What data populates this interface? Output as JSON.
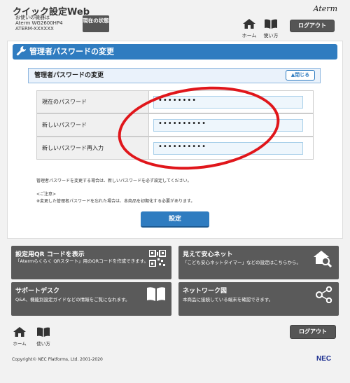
{
  "header": {
    "app_title": "クイック設定Web",
    "device_label": "お使いの機器は",
    "device_model": "Aterm WG2600HP4",
    "device_id": "ATERM-XXXXXX",
    "status_button": "現在の状態",
    "brand": "Aterm",
    "home_label": "ホーム",
    "help_label": "使い方",
    "logout_label": "ログアウト"
  },
  "main": {
    "page_title": "管理者パスワードの変更",
    "section_title": "管理者パスワードの変更",
    "close_label": "▲閉じる",
    "fields": [
      {
        "label": "現在のパスワード",
        "value": "••••••••"
      },
      {
        "label": "新しいパスワード",
        "value": "••••••••••"
      },
      {
        "label": "新しいパスワード再入力",
        "value": "••••••••••"
      }
    ],
    "note1": "管理者パスワードを変更する場合は、新しいパスワードを必ず設定してください。",
    "note_head": "<ご注意>",
    "note2": "※変更した管理者パスワードを忘れた場合は、本商品を初期化する必要があります。",
    "submit_label": "設定"
  },
  "tiles": [
    {
      "title": "設定用QR コードを表示",
      "desc": "「Atermらくらく QRスタート」用のQRコードを作成できます。",
      "icon": "qr-code-icon"
    },
    {
      "title": "見えて安心ネット",
      "desc": "「こども安心ネットタイマー」などの設定はこちらから。",
      "icon": "house-search-icon"
    },
    {
      "title": "サポートデスク",
      "desc": "Q&A、機能別設定ガイドなどの情報をご覧になれます。",
      "icon": "book-icon"
    },
    {
      "title": "ネットワーク図",
      "desc": "本商品に接続している端末を確認できます。",
      "icon": "network-icon"
    }
  ],
  "footer": {
    "home_label": "ホーム",
    "help_label": "使い方",
    "logout_label": "ログアウト",
    "copyright": "Copyright© NEC Platforms, Ltd. 2001-2020",
    "logo": "NEC"
  },
  "colors": {
    "accent": "#2f7cc0",
    "tile": "#5a5a5a",
    "annotation": "#e0161b"
  }
}
